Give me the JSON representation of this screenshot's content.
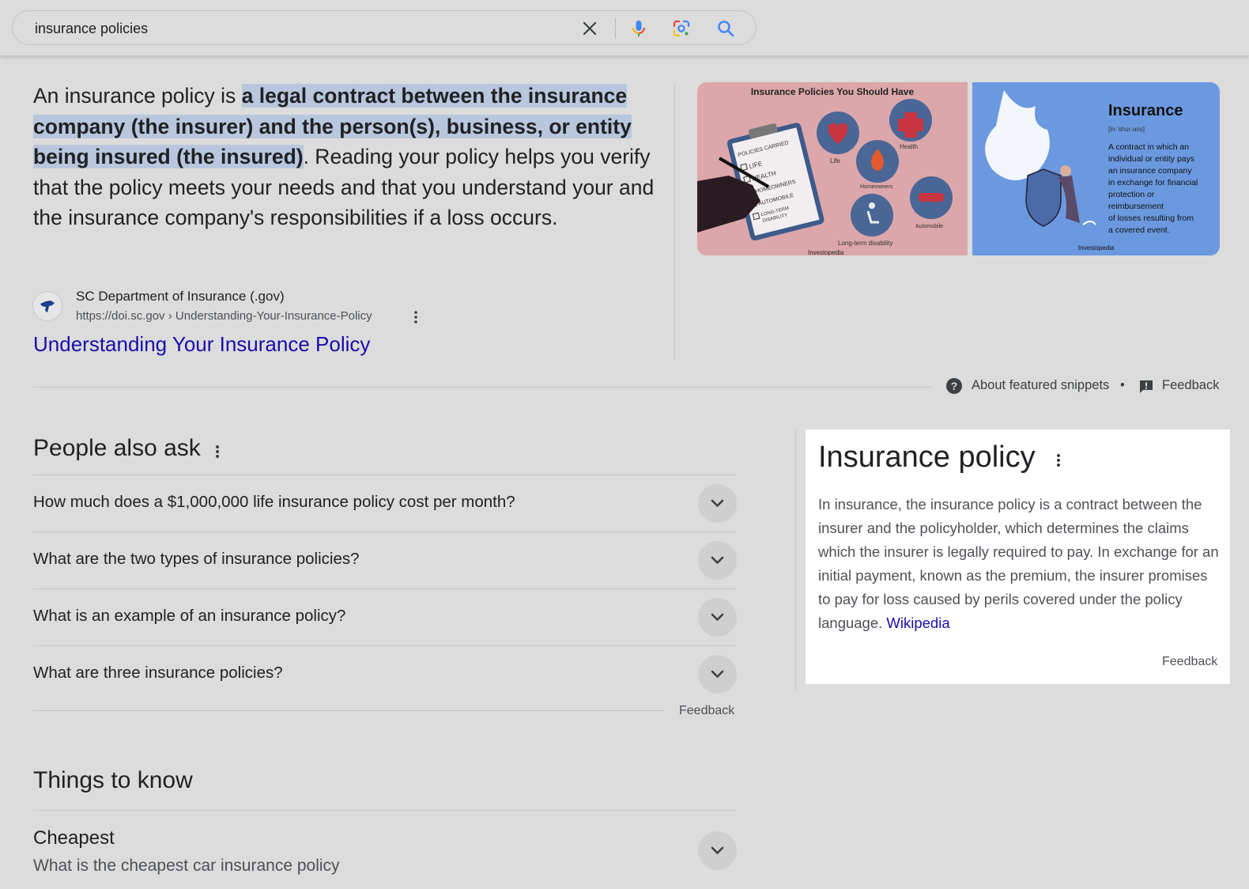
{
  "search": {
    "query": "insurance policies",
    "clear_label": "Clear",
    "voice_label": "Search by voice",
    "lens_label": "Search by image",
    "submit_label": "Search"
  },
  "snippet": {
    "lead": "An insurance policy is ",
    "highlight": "a legal contract between the insurance company (the insurer) and the person(s), business, or entity being insured (the insured)",
    "rest": ". Reading your policy helps you verify that the policy meets your needs and that you understand your and the insurance company's responsibilities if a loss occurs.",
    "source_name": "SC Department of Insurance (.gov)",
    "source_url": "https://doi.sc.gov › Understanding-Your-Insurance-Policy",
    "title": "Understanding Your Insurance Policy",
    "images": [
      {
        "heading": "Insurance Policies You Should Have",
        "list": [
          "POLICIES CARRIED",
          "LIFE",
          "HEALTH",
          "HOMEOWNERS",
          "AUTOMOBILE",
          "LONG-TERM",
          "DISABILITY"
        ],
        "labels": [
          "Life",
          "Health",
          "Homeowners",
          "Automobile",
          "Long-term disability"
        ],
        "credit": "Investopedia"
      },
      {
        "heading": "Insurance",
        "pron": "[in-'shur-ans]",
        "lines": [
          "A contract in which an",
          "individual or entity pays",
          "an insurance company",
          "in exchange for financial",
          "protection or",
          "reimbursement",
          "of losses resulting from",
          "a covered event."
        ],
        "credit": "Investopedia"
      }
    ],
    "about_label": "About featured snippets",
    "separator": "•",
    "feedback_label": "Feedback"
  },
  "paa": {
    "title": "People also ask",
    "questions": [
      "How much does a $1,000,000 life insurance policy cost per month?",
      "What are the two types of insurance policies?",
      "What is an example of an insurance policy?",
      "What are three insurance policies?"
    ],
    "feedback_label": "Feedback"
  },
  "things_to_know": {
    "title": "Things to know",
    "items": [
      {
        "heading": "Cheapest",
        "sub": "What is the cheapest car insurance policy"
      }
    ]
  },
  "knowledge_panel": {
    "title": "Insurance policy",
    "description": "In insurance, the insurance policy is a contract between the insurer and the policyholder, which determines the claims which the insurer is legally required to pay. In exchange for an initial payment, known as the premium, the insurer promises to pay for loss caused by perils covered under the policy language. ",
    "source_link": "Wikipedia",
    "feedback_label": "Feedback"
  },
  "colors": {
    "background": "#dcdcdc",
    "link": "#1a0dab",
    "highlight": "#b8c7dd",
    "image_pink": "#dca7aa",
    "image_blue": "#6b99e0"
  }
}
